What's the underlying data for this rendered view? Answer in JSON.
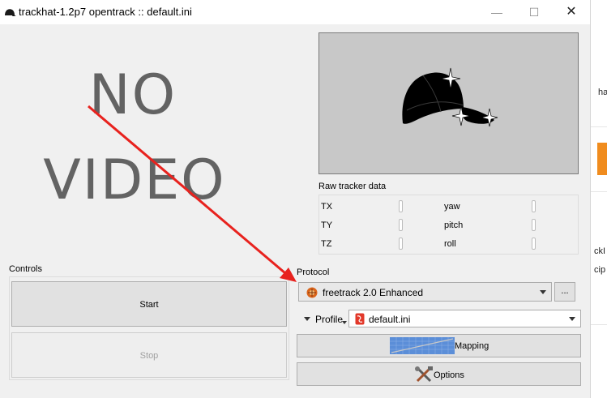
{
  "window": {
    "title": "trackhat-1.2p7 opentrack :: default.ini",
    "minimize": "—",
    "maximize": "☐",
    "close": "✕"
  },
  "video": {
    "line1": "NO",
    "line2": "VIDEO"
  },
  "raw_tracker": {
    "title": "Raw tracker data",
    "left": [
      "TX",
      "TY",
      "TZ"
    ],
    "right": [
      "yaw",
      "pitch",
      "roll"
    ]
  },
  "controls": {
    "title": "Controls",
    "start_label": "Start",
    "stop_label": "Stop"
  },
  "protocol": {
    "title": "Protocol",
    "selected": "freetrack 2.0 Enhanced",
    "more_label": "..."
  },
  "profile": {
    "label": "Profile",
    "selected": "default.ini"
  },
  "buttons": {
    "mapping_label": "Mapping",
    "options_label": "Options"
  },
  "background_window": {
    "texts": [
      "ha",
      "ckI",
      "cip"
    ]
  },
  "colors": {
    "arrow": "#e8221e",
    "accent": "#f08c1e"
  }
}
